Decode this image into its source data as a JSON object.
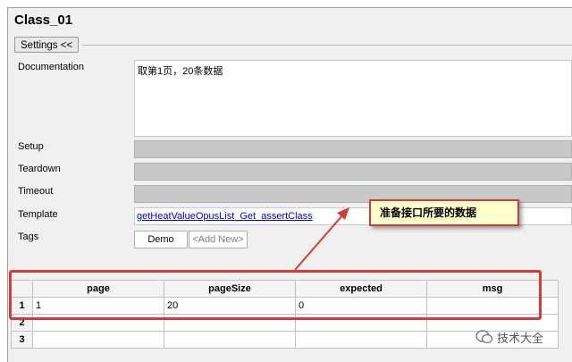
{
  "title": "Class_01",
  "settings_button": "Settings <<",
  "fields": {
    "documentation_label": "Documentation",
    "documentation_value": "取第1页，20条数据",
    "setup_label": "Setup",
    "teardown_label": "Teardown",
    "timeout_label": "Timeout",
    "template_label": "Template",
    "template_value": "getHeatValueOpusList_Get_assertClass",
    "tags_label": "Tags",
    "tag_demo": "Demo",
    "tag_add_new": "<Add New>"
  },
  "callout": "准备接口所要的数据",
  "table": {
    "columns": [
      "page",
      "pageSize",
      "expected",
      "msg"
    ],
    "rows": [
      {
        "num": "1",
        "cells": [
          "1",
          "20",
          "0",
          ""
        ]
      },
      {
        "num": "2",
        "cells": [
          "",
          "",
          "",
          ""
        ]
      },
      {
        "num": "3",
        "cells": [
          "",
          "",
          "",
          ""
        ]
      }
    ]
  },
  "watermark": "技术大全",
  "colors": {
    "annotation": "#d43a3a",
    "callout_bg": "#ffffcc",
    "link": "#0000cc"
  }
}
